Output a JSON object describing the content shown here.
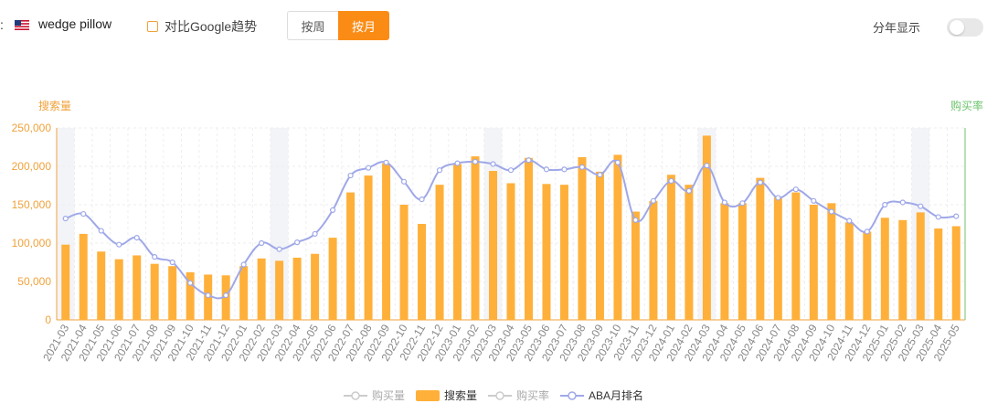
{
  "header": {
    "colon": ":",
    "keyword": "wedge pillow",
    "compare_label": "对比Google趋势",
    "week_label": "按周",
    "month_label": "按月",
    "year_view_label": "分年显示"
  },
  "colors": {
    "bar": "#ffb03a",
    "line": "#9fa8e8",
    "active": "#fa8c16",
    "right_axis": "#6cc36c"
  },
  "chart_data": {
    "type": "bar",
    "left_axis_label": "搜索量",
    "right_axis_label": "购买率",
    "ylim": [
      0,
      250000
    ],
    "yticks": [
      "0",
      "50,000",
      "100,000",
      "150,000",
      "200,000",
      "250,000"
    ],
    "categories": [
      "2021-03",
      "2021-04",
      "2021-05",
      "2021-06",
      "2021-07",
      "2021-08",
      "2021-09",
      "2021-10",
      "2021-11",
      "2021-12",
      "2022-01",
      "2022-02",
      "2022-03",
      "2022-04",
      "2022-05",
      "2022-06",
      "2022-07",
      "2022-08",
      "2022-09",
      "2022-10",
      "2022-11",
      "2022-12",
      "2023-01",
      "2023-02",
      "2023-03",
      "2023-04",
      "2023-05",
      "2023-06",
      "2023-07",
      "2023-08",
      "2023-09",
      "2023-10",
      "2023-11",
      "2023-12",
      "2024-01",
      "2024-02",
      "2024-03",
      "2024-04",
      "2024-05",
      "2024-06",
      "2024-07",
      "2024-08",
      "2024-09",
      "2024-10",
      "2024-11",
      "2024-12",
      "2025-01",
      "2025-02",
      "2025-03",
      "2025-04",
      "2025-05"
    ],
    "series": [
      {
        "name": "搜索量",
        "type": "bar",
        "values": [
          98000,
          112000,
          89000,
          79000,
          84000,
          73000,
          70000,
          62000,
          59000,
          58000,
          70000,
          80000,
          77000,
          81000,
          86000,
          107000,
          166000,
          188000,
          204000,
          150000,
          125000,
          176000,
          203000,
          213000,
          194000,
          178000,
          211000,
          177000,
          176000,
          212000,
          193000,
          215000,
          141000,
          155000,
          189000,
          176000,
          240000,
          152000,
          152000,
          185000,
          160000,
          166000,
          150000,
          152000,
          127000,
          115000,
          133000,
          130000,
          140000,
          119000,
          122000
        ]
      },
      {
        "name": "ABA月排名",
        "type": "line",
        "values": [
          132000,
          138000,
          116000,
          98000,
          107000,
          82000,
          75000,
          48000,
          32000,
          32000,
          72000,
          100000,
          92000,
          101000,
          112000,
          143000,
          188000,
          198000,
          205000,
          180000,
          157000,
          195000,
          204000,
          206000,
          203000,
          195000,
          208000,
          196000,
          196000,
          199000,
          189000,
          205000,
          130000,
          155000,
          181000,
          168000,
          201000,
          153000,
          152000,
          179000,
          159000,
          170000,
          155000,
          141000,
          129000,
          115000,
          150000,
          153000,
          148000,
          134000,
          135000
        ]
      }
    ],
    "legend": [
      {
        "name": "购买量",
        "style": "line-inactive"
      },
      {
        "name": "搜索量",
        "style": "bar"
      },
      {
        "name": "购买率",
        "style": "line-inactive"
      },
      {
        "name": "ABA月排名",
        "style": "line"
      }
    ],
    "shaded_categories": [
      "2021-03",
      "2022-03",
      "2023-03",
      "2024-03",
      "2025-03"
    ],
    "legend_position": "bottom",
    "grid": true
  }
}
